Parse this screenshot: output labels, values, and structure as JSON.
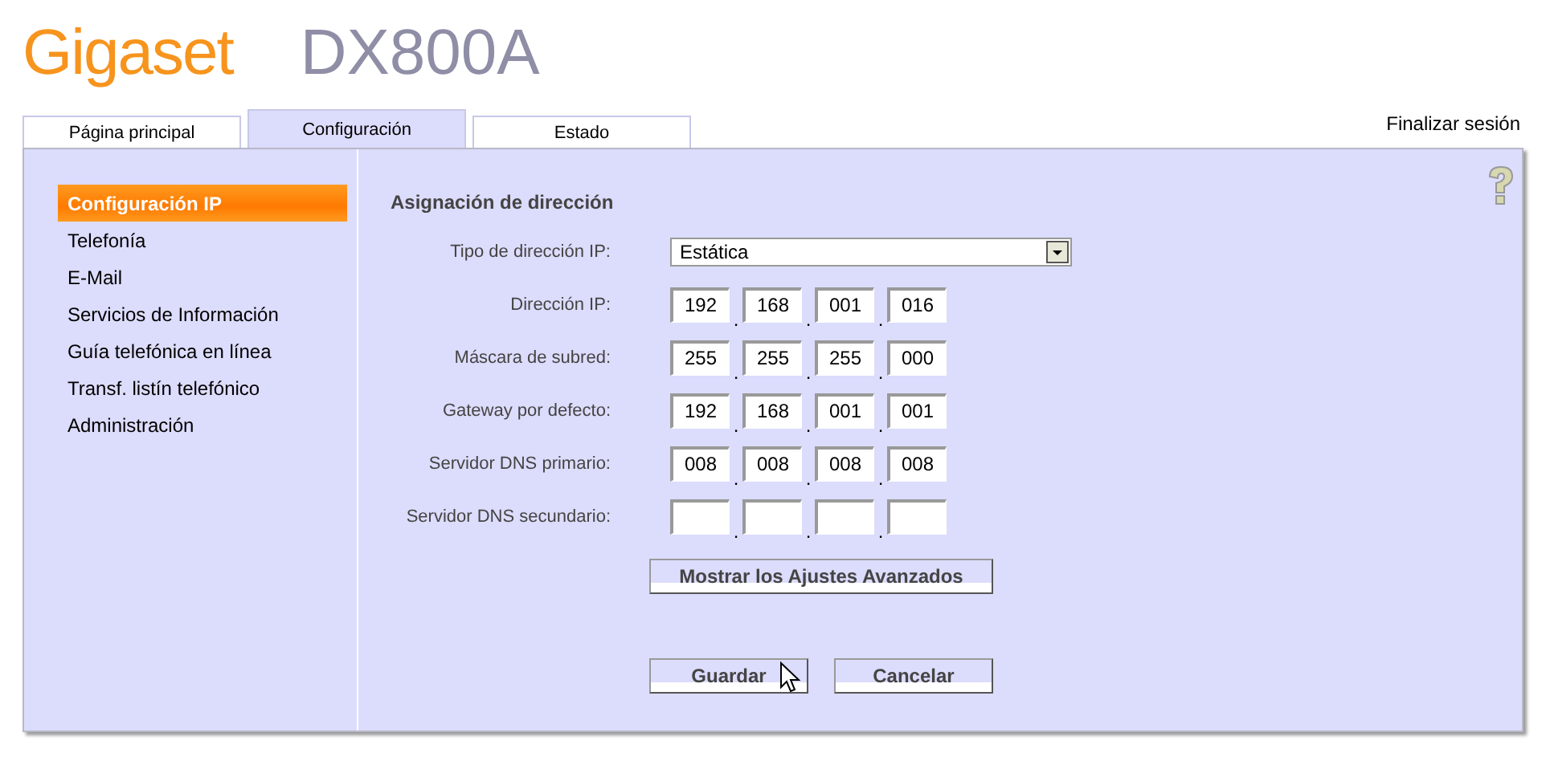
{
  "header": {
    "brand": "Gigaset",
    "model": "DX800A"
  },
  "tabs": [
    {
      "label": "Página principal",
      "selected": false
    },
    {
      "label": "Configuración",
      "selected": true
    },
    {
      "label": "Estado",
      "selected": false
    }
  ],
  "logout": "Finalizar sesión",
  "sidebar": {
    "items": [
      {
        "label": "Configuración IP",
        "selected": true
      },
      {
        "label": "Telefonía",
        "selected": false
      },
      {
        "label": "E-Mail",
        "selected": false
      },
      {
        "label": "Servicios de Información",
        "selected": false
      },
      {
        "label": "Guía telefónica en línea",
        "selected": false
      },
      {
        "label": "Transf. listín telefónico",
        "selected": false
      },
      {
        "label": "Administración",
        "selected": false
      }
    ]
  },
  "form": {
    "section_title": "Asignación de dirección",
    "fields": [
      {
        "kind": "select",
        "label": "Tipo de dirección IP:",
        "value": "Estática"
      },
      {
        "kind": "ip",
        "label": "Dirección IP:",
        "octets": [
          "192",
          "168",
          "001",
          "016"
        ]
      },
      {
        "kind": "ip",
        "label": "Máscara de subred:",
        "octets": [
          "255",
          "255",
          "255",
          "000"
        ]
      },
      {
        "kind": "ip",
        "label": "Gateway por defecto:",
        "octets": [
          "192",
          "168",
          "001",
          "001"
        ]
      },
      {
        "kind": "ip",
        "label": "Servidor DNS primario:",
        "octets": [
          "008",
          "008",
          "008",
          "008"
        ]
      },
      {
        "kind": "ip",
        "label": "Servidor DNS secundario:"
      }
    ],
    "separator": ".",
    "advanced_button": "Mostrar los Ajustes Avanzados",
    "buttons": [
      "Guardar",
      "Cancelar"
    ]
  }
}
